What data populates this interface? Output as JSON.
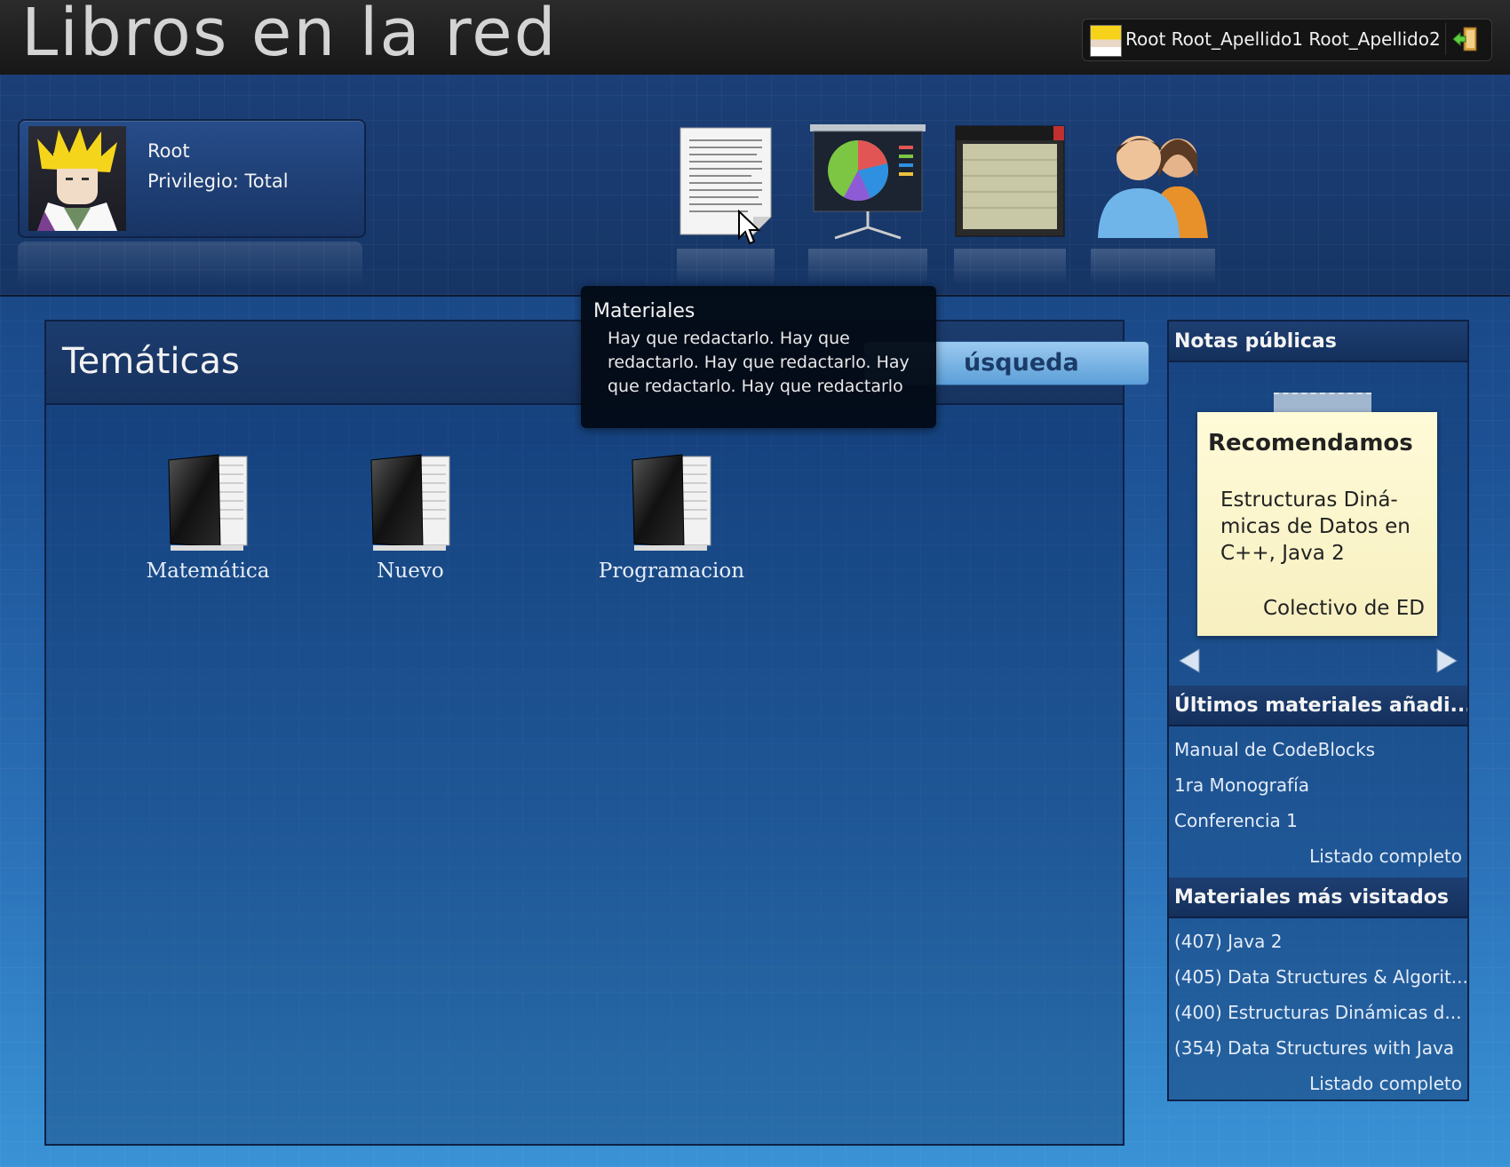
{
  "app_title": "Libros en la red",
  "user": {
    "display_name": "Root Root_Apellido1 Root_Apellido2"
  },
  "profile": {
    "name": "Root",
    "privilege": "Privilegio: Total"
  },
  "nav": [
    {
      "id": "materiales",
      "icon": "document-icon"
    },
    {
      "id": "presentations",
      "icon": "presentation-chart-icon"
    },
    {
      "id": "calendar",
      "icon": "board-icon"
    },
    {
      "id": "users",
      "icon": "users-icon"
    }
  ],
  "tooltip": {
    "title": "Materiales",
    "body": "Hay que redactarlo. Hay que redactarlo. Hay que redactarlo. Hay que redactarlo. Hay que redactarlo"
  },
  "main": {
    "title": "Temáticas",
    "search_label": "úsqueda",
    "folders": [
      "Matemática",
      "Nuevo",
      "Programacion"
    ]
  },
  "sidebar": {
    "notes": {
      "title": "Notas públicas",
      "note_title": "Recomendamos",
      "note_body": "Estructuras Diná-micas de Datos en C++, Java 2",
      "note_author": "Colectivo de ED"
    },
    "latest": {
      "title": "Últimos materiales añadi...",
      "items": [
        "Manual de CodeBlocks",
        "1ra Monografía",
        "Conferencia 1"
      ],
      "link": "Listado completo"
    },
    "most_visited": {
      "title": "Materiales más visitados",
      "items": [
        "(407) Java 2",
        "(405) Data Structures & Algorit...",
        "(400) Estructuras Dinámicas d...",
        "(354) Data Structures with Java"
      ],
      "link": "Listado completo"
    }
  },
  "colors": {
    "header": "#1b3f78",
    "topbar": "#1f1f1f",
    "note": "#fbf5cc",
    "search": "#7cb8e8"
  }
}
